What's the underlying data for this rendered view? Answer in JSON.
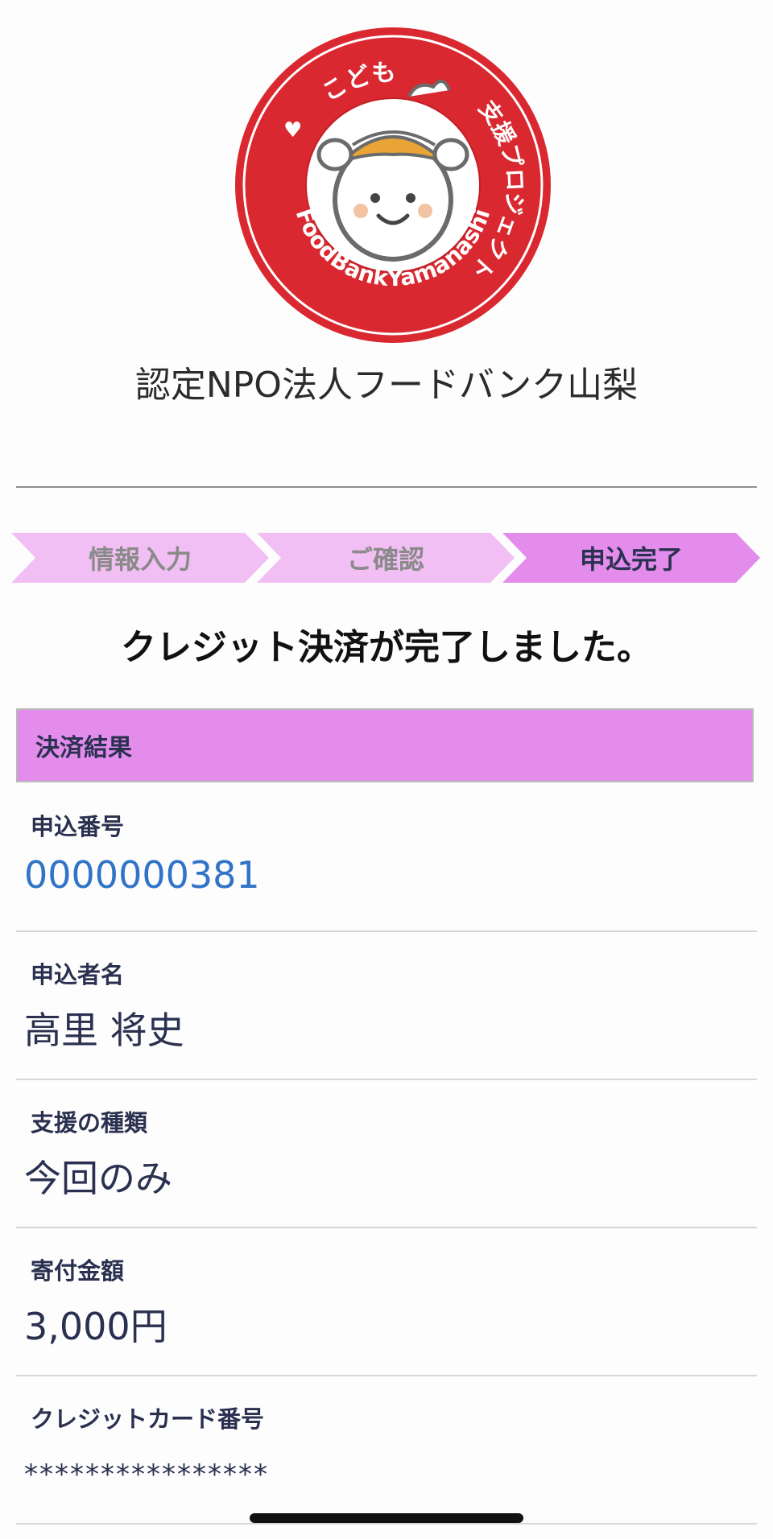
{
  "logo": {
    "top_text": "こども",
    "right_text": "支援プロジェクト",
    "bottom_text": "FoodBankYamanashi",
    "heart": "♥",
    "ring_color": "#d9282f"
  },
  "org_name": "認定NPO法人フードバンク山梨",
  "steps": [
    {
      "label": "情報入力",
      "active": false
    },
    {
      "label": "ご確認",
      "active": false
    },
    {
      "label": "申込完了",
      "active": true
    }
  ],
  "colors": {
    "step_inactive": "#f2bff4",
    "step_active": "#e38cec",
    "header_bg": "#e38cec",
    "link": "#2f74c7",
    "text": "#2a3150"
  },
  "complete_message": "クレジット決済が完了しました。",
  "section_header": "決済結果",
  "fields": [
    {
      "label": "申込番号",
      "value": "0000000381"
    },
    {
      "label": "申込者名",
      "value": "高里 将史"
    },
    {
      "label": "支援の種類",
      "value": "今回のみ"
    },
    {
      "label": "寄付金額",
      "value": "3,000円"
    },
    {
      "label": "クレジットカード番号",
      "value": "****************"
    }
  ]
}
